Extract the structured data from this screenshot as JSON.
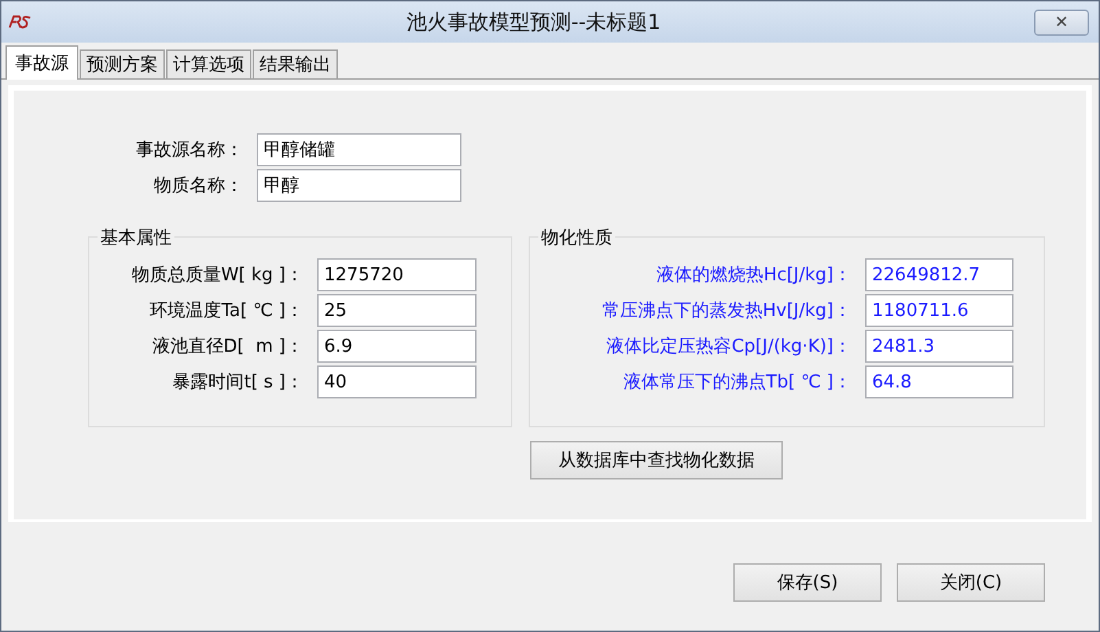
{
  "window": {
    "title": "池火事故模型预测--未标题1",
    "close_label": "✕"
  },
  "tabs": [
    {
      "label": "事故源",
      "selected": true
    },
    {
      "label": "预测方案",
      "selected": false
    },
    {
      "label": "计算选项",
      "selected": false
    },
    {
      "label": "结果输出",
      "selected": false
    }
  ],
  "source_fields": [
    {
      "label": "事故源名称：",
      "value": "甲醇储罐"
    },
    {
      "label": "物质名称：",
      "value": "甲醇"
    }
  ],
  "groups": [
    {
      "title": "基本属性",
      "kind": "basic",
      "fields": [
        {
          "label": "物质总质量W[ kg ]：",
          "value": "1275720"
        },
        {
          "label": "环境温度Ta[ ℃ ]：",
          "value": "25"
        },
        {
          "label": "液池直径D[  m ]：",
          "value": "6.9"
        },
        {
          "label": "暴露时间t[ s ]：",
          "value": "40"
        }
      ]
    },
    {
      "title": "物化性质",
      "kind": "physical",
      "fields": [
        {
          "label": "液体的燃烧热Hc[J/kg]：",
          "value": "22649812.7"
        },
        {
          "label": "常压沸点下的蒸发热Hv[J/kg]：",
          "value": "1180711.6"
        },
        {
          "label": "液体比定压热容Cp[J/(kg·K)]：",
          "value": "2481.3"
        },
        {
          "label": "液体常压下的沸点Tb[ ℃ ]：",
          "value": "64.8"
        }
      ]
    }
  ],
  "lookup_button": "从数据库中查找物化数据",
  "buttons": [
    "保存(S)",
    "关闭(C)"
  ]
}
